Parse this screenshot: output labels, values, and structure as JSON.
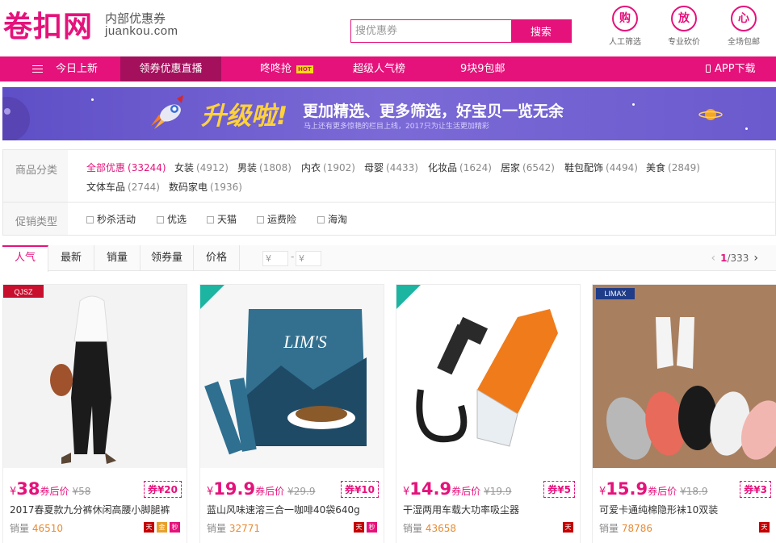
{
  "brand": {
    "logo_text": "卷扣网",
    "subtitle": "内部优惠券",
    "domain": "juankou.com"
  },
  "search": {
    "placeholder": "搜优惠券",
    "button": "搜索"
  },
  "features": [
    {
      "glyph": "购",
      "label": "人工筛选"
    },
    {
      "glyph": "放",
      "label": "专业砍价"
    },
    {
      "glyph": "心",
      "label": "全场包邮"
    }
  ],
  "nav": {
    "items": [
      "今日上新",
      "领券优惠直播",
      "咚咚抢",
      "超级人气榜",
      "9块9包邮"
    ],
    "hot_badge": "HOT",
    "app_download": "APP下载"
  },
  "banner": {
    "headline": "升级啦!",
    "main_text": "更加精选、更多筛选，好宝贝一览无余",
    "small_text": "马上还有更多惊艳的栏目上线，2017只为让生活更加精彩"
  },
  "filters": {
    "category_label": "商品分类",
    "categories": [
      {
        "name": "全部优惠",
        "count": "(33244)"
      },
      {
        "name": "女装",
        "count": "(4912)"
      },
      {
        "name": "男装",
        "count": "(1808)"
      },
      {
        "name": "内衣",
        "count": "(1902)"
      },
      {
        "name": "母婴",
        "count": "(4433)"
      },
      {
        "name": "化妆品",
        "count": "(1624)"
      },
      {
        "name": "居家",
        "count": "(6542)"
      },
      {
        "name": "鞋包配饰",
        "count": "(4494)"
      },
      {
        "name": "美食",
        "count": "(2849)"
      },
      {
        "name": "文体车品",
        "count": "(2744)"
      },
      {
        "name": "数码家电",
        "count": "(1936)"
      }
    ],
    "promo_label": "促销类型",
    "promos": [
      "秒杀活动",
      "优选",
      "天猫",
      "运费险",
      "海淘"
    ]
  },
  "sort": {
    "tabs": [
      "人气",
      "最新",
      "销量",
      "领券量",
      "价格"
    ],
    "price_min_placeholder": "¥",
    "price_max_placeholder": "¥",
    "page_current": "1",
    "page_total": "/333"
  },
  "products": [
    {
      "price": "38",
      "after": "券后价",
      "orig": "¥58",
      "coupon": "券¥20",
      "title": "2017春夏款九分裤休闲高腰小脚腿裤",
      "sales_label": "销量",
      "sales": "46510",
      "badge_label": "QJSZ"
    },
    {
      "price": "19.9",
      "after": "券后价",
      "orig": "¥29.9",
      "coupon": "券¥10",
      "title": "蓝山风味速溶三合一咖啡40袋640g",
      "sales_label": "销量",
      "sales": "32771",
      "badge_label": "LIM'S"
    },
    {
      "price": "14.9",
      "after": "券后价",
      "orig": "¥19.9",
      "coupon": "券¥5",
      "title": "干湿两用车载大功率吸尘器",
      "sales_label": "销量",
      "sales": "43658",
      "badge_label": ""
    },
    {
      "price": "15.9",
      "after": "券后价",
      "orig": "¥18.9",
      "coupon": "券¥3",
      "title": "可爱卡通纯棉隐形袜10双装",
      "sales_label": "销量",
      "sales": "78786",
      "badge_label": "LIMAX"
    }
  ],
  "colors": {
    "brand": "#e5127b",
    "nav_active": "#a4105c",
    "banner": "#6a5acd",
    "sales": "#e88a33"
  }
}
